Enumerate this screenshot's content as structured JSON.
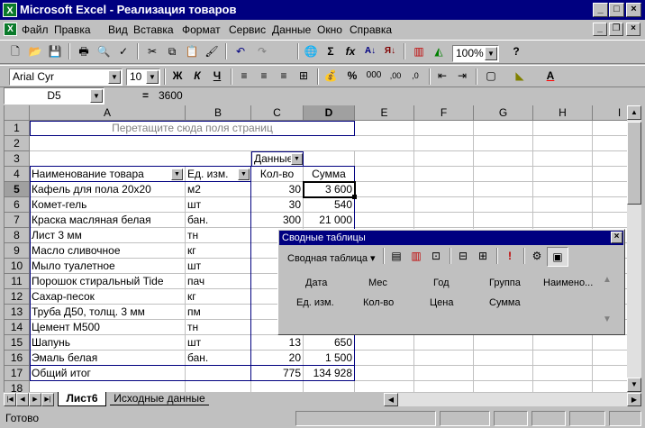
{
  "window": {
    "title": "Microsoft Excel - Реализация товаров",
    "app_icon": "X"
  },
  "menu": [
    "Файл",
    "Правка",
    "Вид",
    "Вставка",
    "Формат",
    "Сервис",
    "Данные",
    "Окно",
    "Справка"
  ],
  "toolbar": {
    "zoom": "100%",
    "font": "Arial Cyr",
    "size": "10",
    "bold": "Ж",
    "italic": "К",
    "underline": "Ч",
    "percent": "%",
    "thousands": "000",
    "currency_icon": "coin-icon"
  },
  "formula": {
    "name_box": "D5",
    "eq": "=",
    "value": "3600"
  },
  "columns": [
    "A",
    "B",
    "C",
    "D",
    "E",
    "F",
    "G",
    "H",
    "I"
  ],
  "rows": [
    "1",
    "2",
    "3",
    "4",
    "5",
    "6",
    "7",
    "8",
    "9",
    "10",
    "11",
    "12",
    "13",
    "14",
    "15",
    "16",
    "17",
    "18"
  ],
  "pivot_table": {
    "page_drop": "Перетащите сюда поля страниц",
    "data_label": "Данные",
    "headers": {
      "name": "Наименование товара",
      "unit": "Ед. изм.",
      "qty": "Кол-во",
      "sum": "Сумма"
    },
    "items": [
      {
        "name": "Кафель для пола 20х20",
        "unit": "м2",
        "qty": "30",
        "sum": "3 600"
      },
      {
        "name": "Комет-гель",
        "unit": "шт",
        "qty": "30",
        "sum": "540"
      },
      {
        "name": "Краска масляная белая",
        "unit": "бан.",
        "qty": "300",
        "sum": "21 000"
      },
      {
        "name": "Лист 3 мм",
        "unit": "тн",
        "qty": "",
        "sum": ""
      },
      {
        "name": "Масло сливочное",
        "unit": "кг",
        "qty": "",
        "sum": ""
      },
      {
        "name": "Мыло туалетное",
        "unit": "шт",
        "qty": "",
        "sum": ""
      },
      {
        "name": "Порошок стиральный Tide",
        "unit": "пач",
        "qty": "",
        "sum": ""
      },
      {
        "name": "Сахар-песок",
        "unit": "кг",
        "qty": "",
        "sum": ""
      },
      {
        "name": "Труба Д50, толщ. 3 мм",
        "unit": "пм",
        "qty": "",
        "sum": ""
      },
      {
        "name": "Цемент М500",
        "unit": "тн",
        "qty": "",
        "sum": ""
      },
      {
        "name": "Шапунь",
        "unit": "шт",
        "qty": "13",
        "sum": "650"
      },
      {
        "name": "Эмаль белая",
        "unit": "бан.",
        "qty": "20",
        "sum": "1 500"
      }
    ],
    "total": {
      "name": "Общий итог",
      "qty": "775",
      "sum": "134 928"
    }
  },
  "pivot_toolbar": {
    "title": "Сводные таблицы",
    "menu": "Сводная таблица",
    "fields_row1": [
      "Дата",
      "Мес",
      "Год",
      "Группа",
      "Наимено..."
    ],
    "fields_row2": [
      "Ед. изм.",
      "Кол-во",
      "Цена",
      "Сумма"
    ]
  },
  "sheets": {
    "active": "Лист6",
    "other": "Исходные данные"
  },
  "status": {
    "text": "Готово"
  }
}
